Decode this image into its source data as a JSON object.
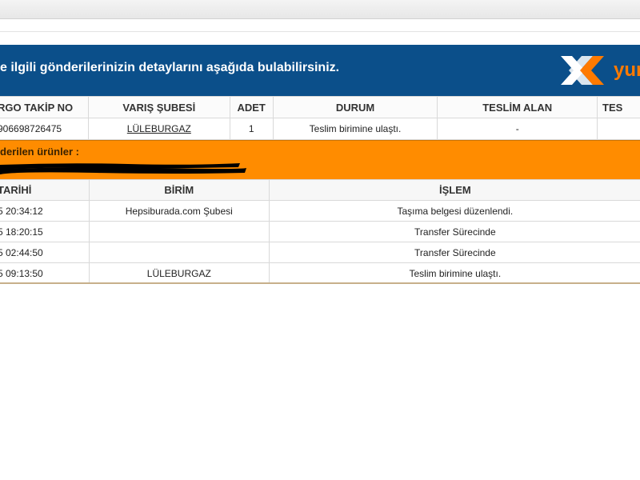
{
  "banner": {
    "text": "e ilgili gönderilerinizin detaylarını aşağıda bulabilirsiniz.",
    "logo_text": "yur"
  },
  "tracking_table": {
    "headers": [
      "RGO TAKİP NO",
      "VARIŞ ŞUBESİ",
      "ADET",
      "DURUM",
      "TESLİM ALAN",
      "TES"
    ],
    "row": {
      "tracking_no": "906698726475",
      "branch": "LÜLEBURGAZ",
      "count": "1",
      "status": "Teslim birimine ulaştı.",
      "receiver": "-",
      "extra": ""
    }
  },
  "products": {
    "label": "derilen ürünler :"
  },
  "history_table": {
    "headers": [
      "TARİHİ",
      "BİRİM",
      "İŞLEM"
    ],
    "rows": [
      {
        "date": "5 20:34:12",
        "unit": "Hepsiburada.com Şubesi",
        "action": "Taşıma belgesi düzenlendi."
      },
      {
        "date": "5 18:20:15",
        "unit": "",
        "action": "Transfer Sürecinde"
      },
      {
        "date": "5 02:44:50",
        "unit": "",
        "action": "Transfer Sürecinde"
      },
      {
        "date": "5 09:13:50",
        "unit": "LÜLEBURGAZ",
        "action": "Teslim birimine ulaştı."
      }
    ]
  },
  "colors": {
    "banner": "#0b4f8a",
    "accent_orange": "#ff8c00"
  }
}
